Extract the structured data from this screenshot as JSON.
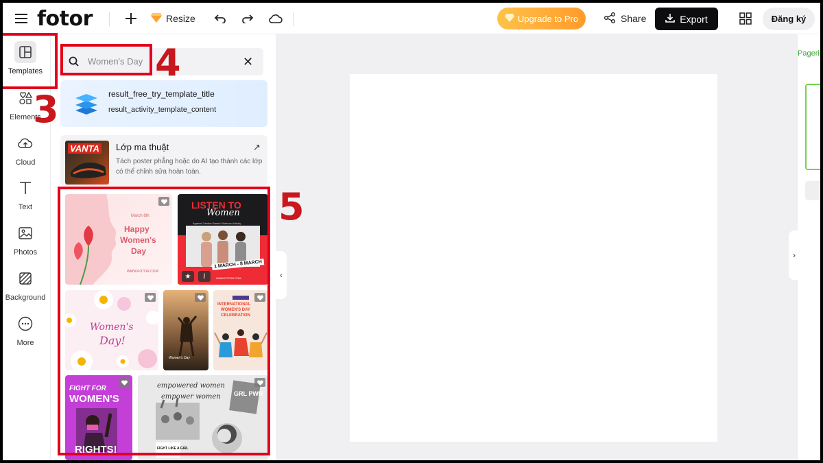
{
  "app": {
    "logo": "fotor"
  },
  "toolbar": {
    "resize_label": "Resize",
    "upgrade_label": "Upgrade to Pro",
    "share_label": "Share",
    "export_label": "Export",
    "signup_label": "Đăng ký"
  },
  "sidebar": {
    "items": [
      {
        "label": "Templates",
        "icon": "templates-icon",
        "active": true
      },
      {
        "label": "Elements",
        "icon": "elements-icon"
      },
      {
        "label": "Cloud",
        "icon": "cloud-upload-icon"
      },
      {
        "label": "Text",
        "icon": "text-icon"
      },
      {
        "label": "Photos",
        "icon": "photos-icon"
      },
      {
        "label": "Background",
        "icon": "background-icon"
      },
      {
        "label": "More",
        "icon": "more-icon"
      }
    ]
  },
  "panel": {
    "search_value": "Women's Day",
    "promo_title": "result_free_try_template_title",
    "promo_content": "result_activity_template_content",
    "magic": {
      "thumb_text": "VANTA",
      "title": "Lớp ma thuật",
      "desc": "Tách poster phẳng hoặc do AI tạo thành các lớp có thể chỉnh sửa hoàn toàn."
    },
    "templates": [
      {
        "l1": "March 8th",
        "l2": "Happy",
        "l3": "Women's",
        "l4": "Day",
        "site": "WWW.FOTOR.COM"
      },
      {
        "l1": "LISTEN TO",
        "l2": "Women",
        "l3": "Against Gender-Based Violence Activity",
        "l4": "1 MARCH - 8 MARCH",
        "site": "WWW.FOTOR.COM"
      },
      {
        "l1": "Women's",
        "l2": "Day!"
      },
      {
        "l1": "Women's Day"
      },
      {
        "l1": "INTERNATIONAL",
        "l2": "WOMEN'S DAY",
        "l3": "CELEBRATION"
      },
      {
        "l1": "FIGHT FOR",
        "l2": "WOMEN'S",
        "l3": "RIGHTS!"
      },
      {
        "l1": "empowered women",
        "l2": "empower women",
        "l3": "GRL PWR",
        "l4": "FIGHT LIKE A GIRL"
      }
    ]
  },
  "right": {
    "pager_label": "Pageri"
  },
  "annotations": [
    "3",
    "4",
    "5"
  ],
  "colors": {
    "accent": "#e3001b",
    "upgrade": "#ffad35",
    "export": "#0d0d0f"
  }
}
